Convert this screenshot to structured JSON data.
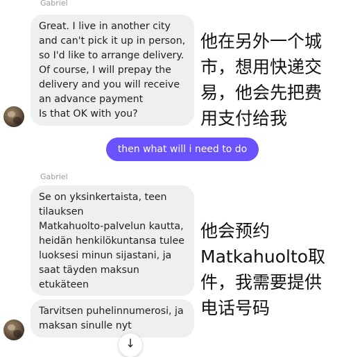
{
  "messages": {
    "group1": {
      "sender": "Gabriel",
      "bubble": "Great. I live in another city\nand can't pick it up in person,\nso I'd like to arrange delivery.\nOf course, I will prepay the\ndelivery and you will receive\nan advance payment\nIs that OK with you?",
      "annotation": "他在另外一个城\n市，想用快递交\n易，他会先把费\n用支付给我"
    },
    "sent": {
      "text": "then what will i need to do"
    },
    "group2": {
      "sender": "Gabriel",
      "bubble1": "Se on yksinkertaista, teen\ntilauksen\nMatkahuolto-palvelun kautta,\nheidän henkilökuntansa tulee\nluoksesi minun sijastani, ja\nsaat täyden maksun\netukäteen",
      "bubble2": "Tarvitsen puhelinnumerosi, ja\nmaksan sinulle nyt",
      "annotation": "他会预约\nMatkahuolto取\n件，我需要提供\n电话号码"
    }
  },
  "icons": {
    "avatar": "avatar-photo",
    "scroll": "arrow-down-icon"
  }
}
